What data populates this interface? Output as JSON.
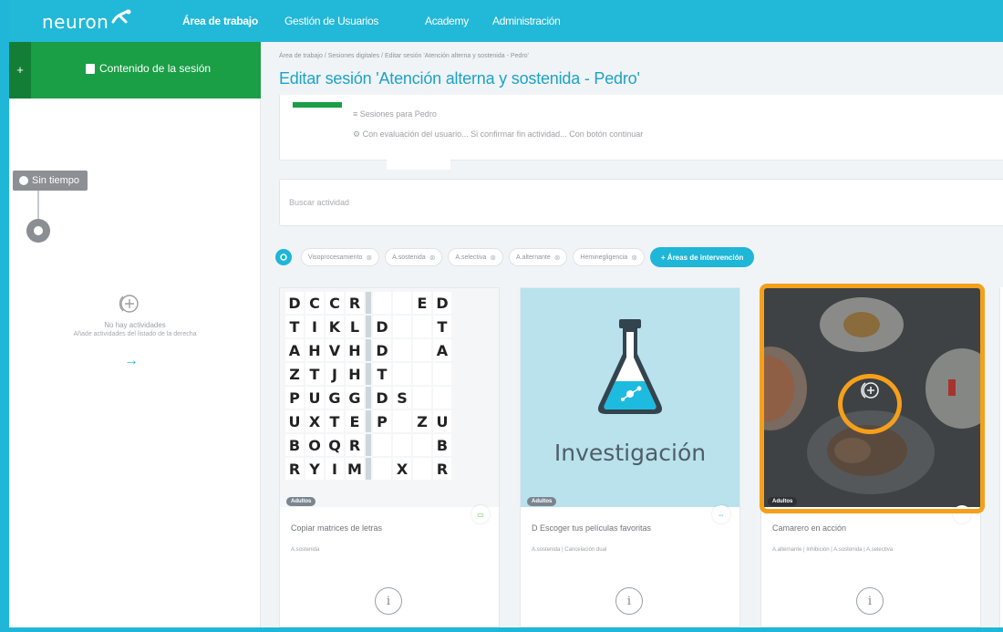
{
  "navbar": {
    "logo": "neuron",
    "items": [
      "Área de trabajo",
      "Gestión de Usuarios",
      "Academy",
      "Administración"
    ]
  },
  "sidebar": {
    "plus": "+",
    "title": "Contenido de la sesión",
    "timer": "Sin tiempo",
    "empty_title": "No hay actividades",
    "empty_sub": "Añade actividades del listado de la derecha"
  },
  "breadcrumb": "Área de trabajo / Sesiones digitales / Editar sesión 'Atención alterna y sostenida - Pedro'",
  "page_title": "Editar sesión 'Atención alterna y sostenida - Pedro'",
  "info": {
    "line1": "Sesiones para Pedro",
    "line2": "Con evaluación del usuario... Si confirmar fin actividad... Con botón continuar"
  },
  "search": {
    "placeholder": "Buscar actividad"
  },
  "filters": {
    "chips": [
      "Visoprocesamiento",
      "A.sostenida",
      "A.selectiva",
      "A.alternante",
      "Heminegligencia"
    ],
    "add_label": "+ Áreas de intervención"
  },
  "cards": [
    {
      "badge": "Adultos",
      "title": "Copiar matrices de letras",
      "tags": "A.sostenida",
      "grid": [
        [
          "D",
          "C",
          "C",
          "R",
          "",
          "",
          "E",
          "D"
        ],
        [
          "T",
          "I",
          "K",
          "L",
          "D",
          "",
          "",
          "T"
        ],
        [
          "A",
          "H",
          "V",
          "H",
          "D",
          "",
          "",
          "A"
        ],
        [
          "Z",
          "T",
          "J",
          "H",
          "T",
          "",
          "",
          ""
        ],
        [
          "P",
          "U",
          "G",
          "G",
          "D",
          "S",
          "",
          ""
        ],
        [
          "U",
          "X",
          "T",
          "E",
          "P",
          "",
          "Z",
          "U"
        ],
        [
          "B",
          "O",
          "Q",
          "R",
          "",
          "",
          "",
          "B"
        ],
        [
          "R",
          "Y",
          "I",
          "M",
          "",
          "X",
          "",
          "R"
        ]
      ]
    },
    {
      "badge": "Adultos",
      "title": "D Escoger tus películas favoritas",
      "tags": "A.sostenida | Cancelación dual",
      "image_label": "Investigación"
    },
    {
      "badge": "Adultos",
      "title": "Camarero en acción",
      "tags": "A.alternante | Inhibición | A.sostenida | A.selectiva"
    }
  ],
  "accent_colors": {
    "teal": "#1fb6d8",
    "green": "#1a9e46",
    "highlight": "#f5a01a"
  }
}
